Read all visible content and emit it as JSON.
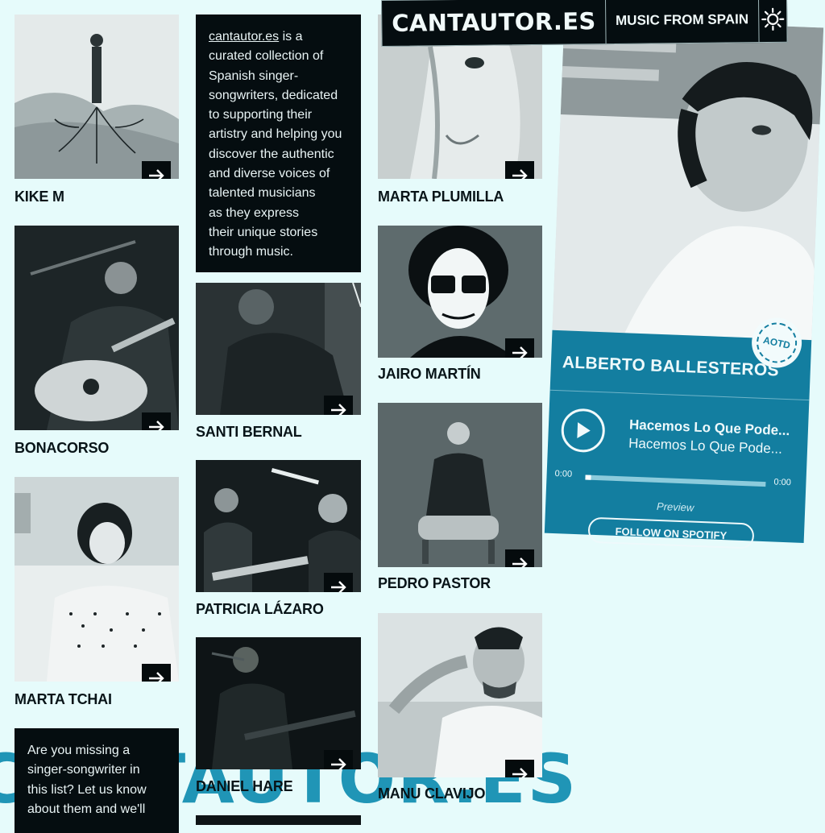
{
  "header": {
    "logo": "CANTAUTOR.ES",
    "tagline": "MUSIC FROM SPAIN",
    "theme_icon": "sun-icon"
  },
  "watermark": "CANTAUTOR.ES",
  "intro": {
    "link_text": "cantautor.es",
    "lines": [
      "is a",
      "curated collection of",
      "Spanish singer-",
      "songwriters, dedicated",
      "to supporting their",
      "artistry and helping you",
      "discover the authentic",
      "and diverse voices of",
      "talented musicians",
      "as they express",
      "their unique stories",
      "through music."
    ]
  },
  "missing": {
    "lines": [
      "Are you missing a",
      "singer-songwriter in",
      "this list? Let us know",
      "about them and we'll"
    ]
  },
  "artists": [
    {
      "name": "KIKE M"
    },
    {
      "name": "BONACORSO"
    },
    {
      "name": "MARTA TCHAI"
    },
    {
      "name": "SANTI BERNAL"
    },
    {
      "name": "PATRICIA LÁZARO"
    },
    {
      "name": "DANIEL HARE"
    },
    {
      "name": "MARTA PLUMILLA"
    },
    {
      "name": "JAIRO MARTÍN"
    },
    {
      "name": "PEDRO PASTOR"
    },
    {
      "name": "MANU CLAVIJO"
    }
  ],
  "featured": {
    "badge": "AOTD",
    "artist": "ALBERTO BALLESTEROS",
    "track_title": "Hacemos Lo Que Pode...",
    "track_subtitle": "Hacemos Lo Que Pode...",
    "time_start": "0:00",
    "time_end": "0:00",
    "progress": 0.03,
    "preview_label": "Preview",
    "follow_label": "FOLLOW ON SPOTIFY"
  },
  "colors": {
    "background": "#e6fbfb",
    "dark": "#050d10",
    "accent": "#137ea0"
  }
}
